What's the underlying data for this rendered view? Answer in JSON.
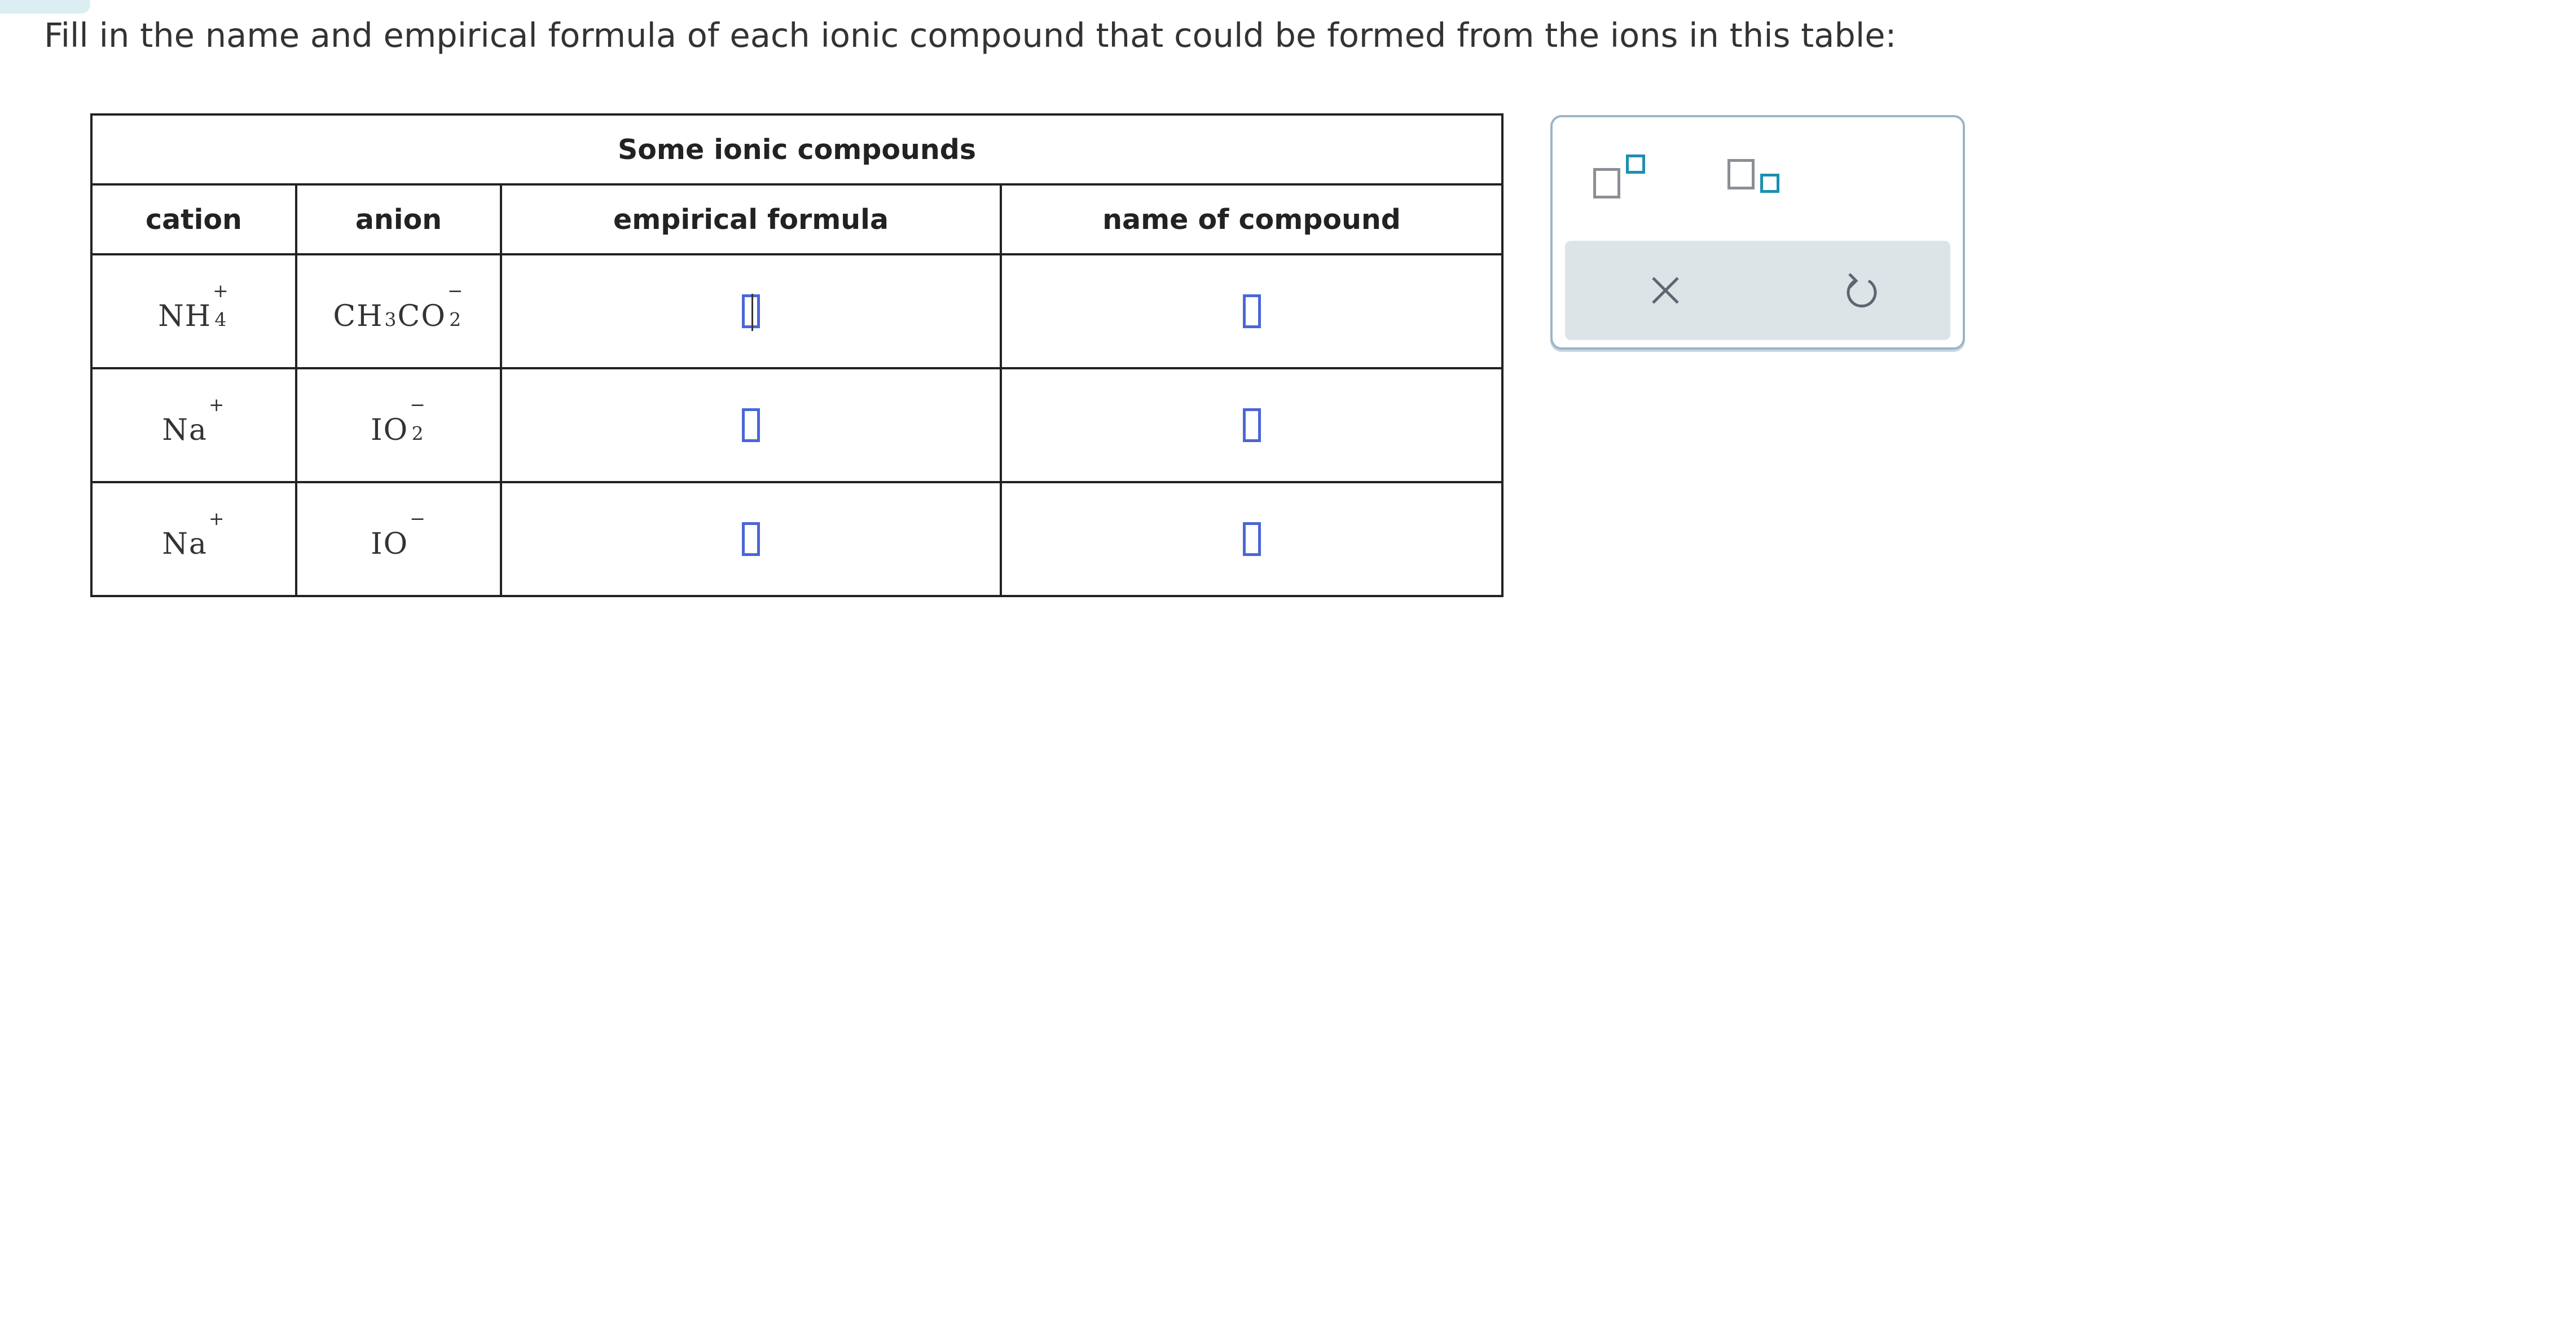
{
  "prompt": "Fill in the name and empirical formula of each ionic compound that could be formed from the ions in this table:",
  "table": {
    "caption": "Some ionic compounds",
    "headers": {
      "cation": "cation",
      "anion": "anion",
      "formula": "empirical formula",
      "name": "name of compound"
    },
    "rows": [
      {
        "cation": {
          "base": "NH",
          "sub": "4",
          "sup": "+"
        },
        "anion": [
          {
            "base": "CH",
            "sub": "3",
            "sup": ""
          },
          {
            "base": "CO",
            "sub": "2",
            "sup": "−"
          }
        ],
        "formula": "",
        "name": ""
      },
      {
        "cation": {
          "base": "Na",
          "sub": "",
          "sup": "+"
        },
        "anion": [
          {
            "base": "IO",
            "sub": "2",
            "sup": "−"
          }
        ],
        "formula": "",
        "name": ""
      },
      {
        "cation": {
          "base": "Na",
          "sub": "",
          "sup": "+"
        },
        "anion": [
          {
            "base": "IO",
            "sub": "",
            "sup": "−"
          }
        ],
        "formula": "",
        "name": ""
      }
    ]
  },
  "toolbar": {
    "superscript_icon": "superscript-template-icon",
    "subscript_icon": "subscript-template-icon",
    "clear_icon": "close-icon",
    "undo_icon": "undo-icon"
  },
  "colors": {
    "answer_box": "#4a66d6",
    "template_small": "#1b8fb0",
    "template_big": "#8a8f96",
    "panel_border": "#9cb5c6",
    "action_bar": "#dde4e8"
  }
}
